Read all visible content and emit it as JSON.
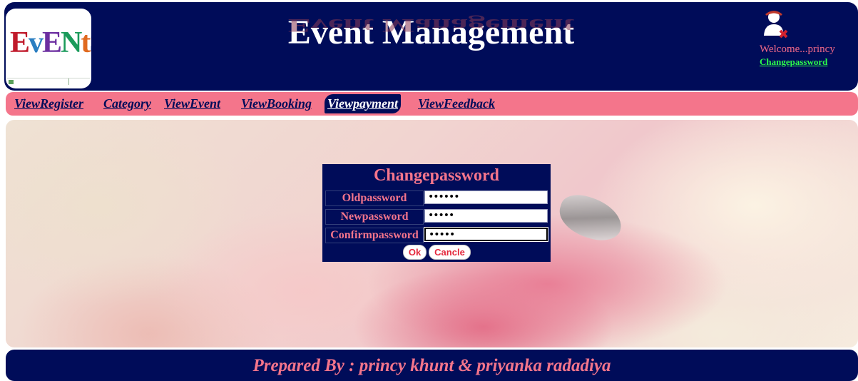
{
  "header": {
    "logo_text": "EvENtS",
    "title": "Event Management",
    "welcome": "Welcome...princy",
    "change_link": "Changepassword"
  },
  "nav": {
    "items": [
      {
        "label": "ViewRegister"
      },
      {
        "label": "Category"
      },
      {
        "label": "ViewEvent"
      },
      {
        "label": "ViewBooking"
      },
      {
        "label": "Viewpayment",
        "active": true
      },
      {
        "label": "ViewFeedback"
      }
    ]
  },
  "form": {
    "title": "Changepassword",
    "fields": [
      {
        "label": "Oldpassword",
        "value": "••••••"
      },
      {
        "label": "Newpassword",
        "value": "•••••"
      },
      {
        "label": "Confirmpassword",
        "value": "•••••"
      }
    ],
    "ok_label": "Ok",
    "cancel_label": "Cancle"
  },
  "footer": {
    "text": "Prepared By : princy khunt & priyanka radadiya"
  },
  "colors": {
    "navy": "#000c59",
    "pink": "#f4758b",
    "link_green": "#2cff4a"
  },
  "icons": {
    "user": "user-remove-icon"
  }
}
